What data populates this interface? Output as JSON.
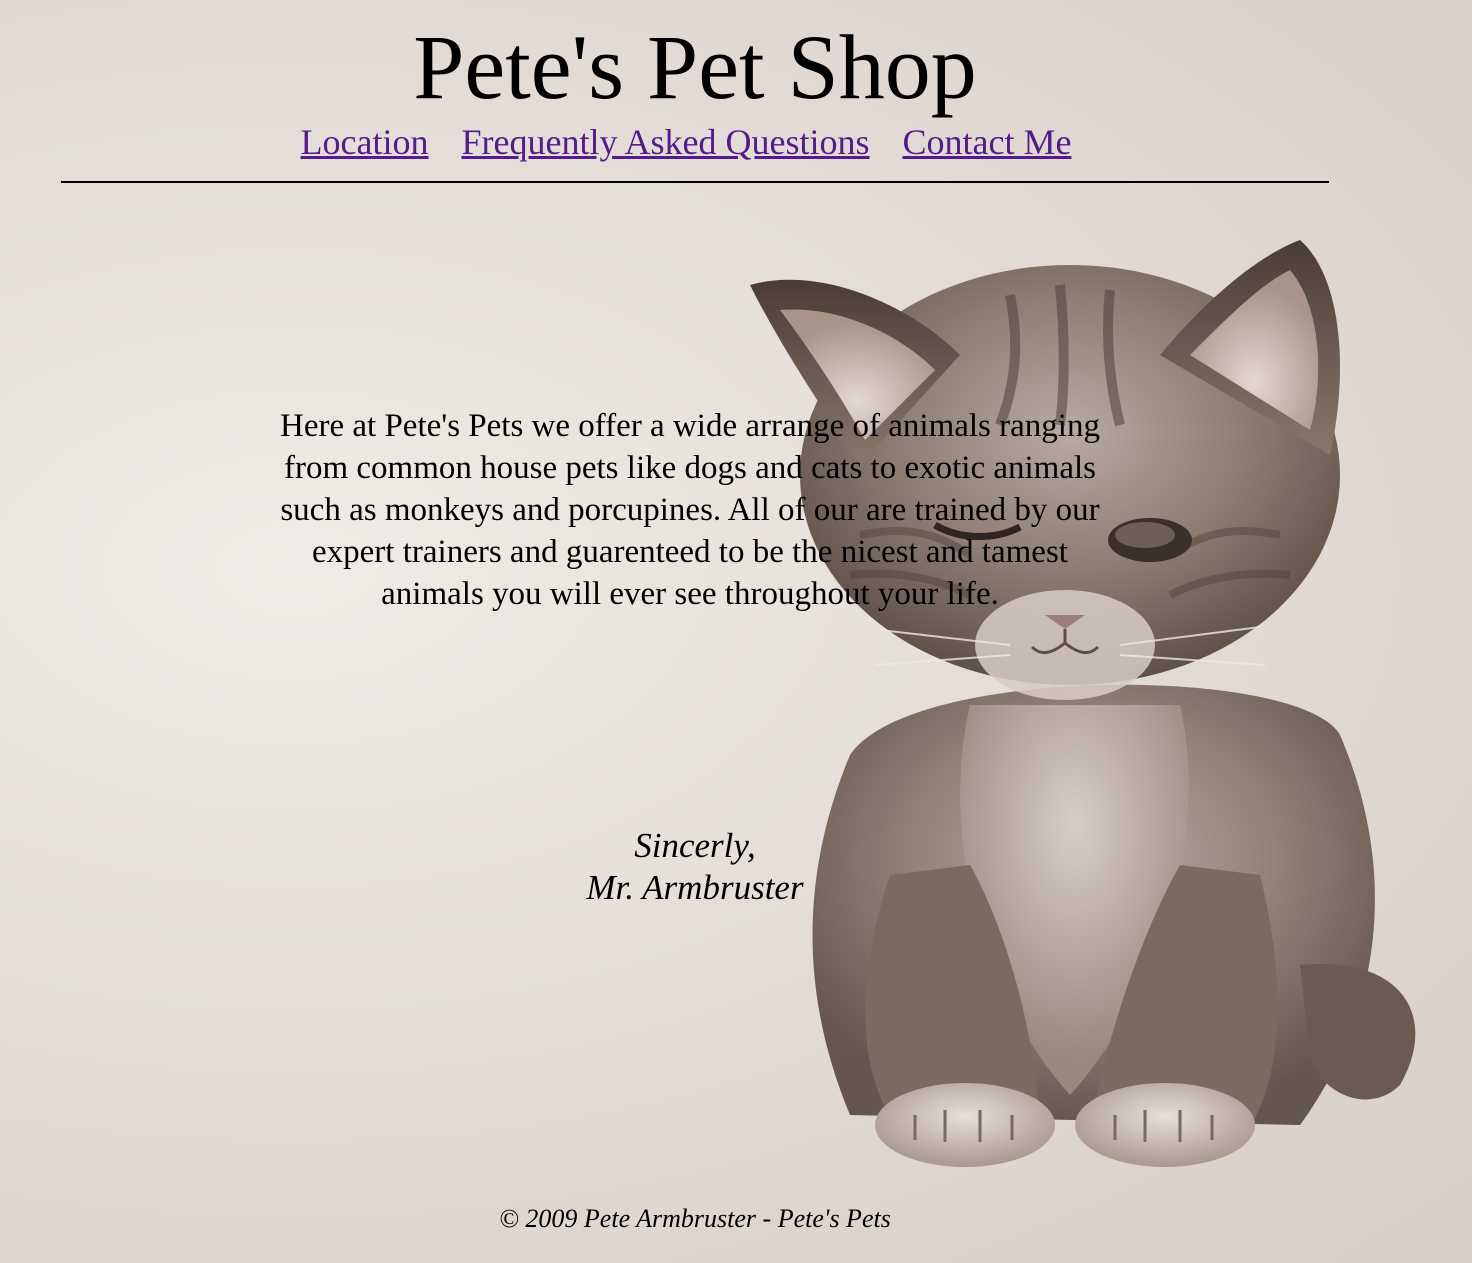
{
  "header": {
    "title": "Pete's Pet Shop"
  },
  "nav": {
    "links": [
      {
        "label": "Location"
      },
      {
        "label": "Frequently Asked Questions"
      },
      {
        "label": "Contact Me"
      }
    ],
    "link_color": "#551a8b"
  },
  "main": {
    "intro": "Here at Pete's Pets we offer a wide arrange of animals ranging from common house pets like dogs and cats to exotic animals such as monkeys and porcupines. All of our are trained by our expert trainers and guarenteed to be the nicest and tamest animals you will ever see throughout your life.",
    "closing": "Sincerly,",
    "signature": "Mr. Armbruster"
  },
  "background": {
    "image": "kitten-photo"
  },
  "footer": {
    "copyright": "© 2009 Pete Armbruster - Pete's Pets"
  }
}
